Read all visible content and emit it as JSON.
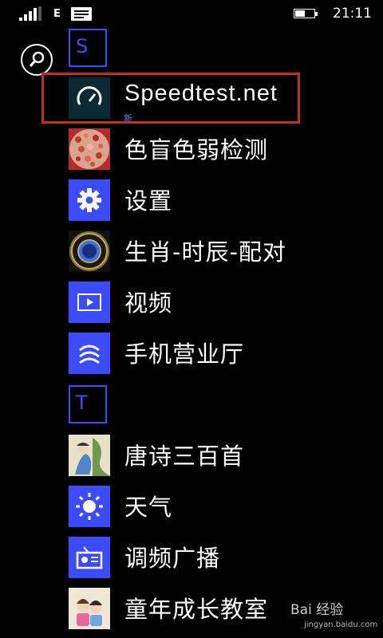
{
  "status_bar": {
    "network": "E",
    "time": "21:11",
    "signal_bars_filled": 4,
    "battery_level": 0.5
  },
  "search": {
    "icon": "search-icon"
  },
  "sections": [
    {
      "letter": "S",
      "apps": [
        {
          "name": "Speedtest.net",
          "badge": "新",
          "tile_color": "#0a2a33",
          "icon": "speedometer-icon"
        },
        {
          "name": "色盲色弱检测",
          "tile_color": "#c8322e",
          "icon": "color-plate-icon"
        },
        {
          "name": "设置",
          "tile_color": "#3b4cff",
          "icon": "gear-icon"
        },
        {
          "name": "生肖-时辰-配对",
          "tile_color": "#111111",
          "icon": "zodiac-wheel-icon"
        },
        {
          "name": "视频",
          "tile_color": "#3b4cff",
          "icon": "video-icon"
        },
        {
          "name": "手机营业厅",
          "tile_color": "#3b4cff",
          "icon": "china-mobile-icon"
        }
      ]
    },
    {
      "letter": "T",
      "apps": [
        {
          "name": "唐诗三百首",
          "tile_color": "#e9e1c7",
          "icon": "poetry-painting-icon"
        },
        {
          "name": "天气",
          "tile_color": "#3b4cff",
          "icon": "sun-icon"
        },
        {
          "name": "调频广播",
          "tile_color": "#3b4cff",
          "icon": "radio-icon"
        },
        {
          "name": "童年成长教室",
          "tile_color": "#efe6d6",
          "icon": "kids-icon"
        }
      ]
    }
  ],
  "colors": {
    "accent": "#3b4cff",
    "highlight": "#c0321e"
  },
  "watermark": {
    "text": "Bai 经验",
    "url": "jingyan.baidu.com"
  }
}
